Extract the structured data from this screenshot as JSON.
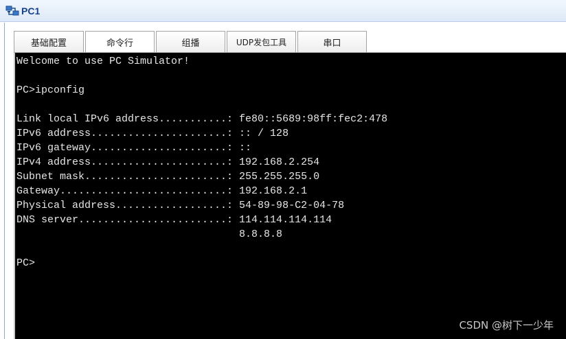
{
  "window": {
    "title": "PC1",
    "icon": "pc-network-icon"
  },
  "tabs": [
    {
      "label": "基础配置",
      "active": false
    },
    {
      "label": "命令行",
      "active": true
    },
    {
      "label": "组播",
      "active": false
    },
    {
      "label": "UDP发包工具",
      "active": false
    },
    {
      "label": "串口",
      "active": false
    }
  ],
  "terminal": {
    "lines": [
      "Welcome to use PC Simulator!",
      "",
      "PC>ipconfig",
      "",
      "Link local IPv6 address...........: fe80::5689:98ff:fec2:478",
      "IPv6 address......................: :: / 128",
      "IPv6 gateway......................: ::",
      "IPv4 address......................: 192.168.2.254",
      "Subnet mask.......................: 255.255.255.0",
      "Gateway...........................: 192.168.2.1",
      "Physical address..................: 54-89-98-C2-04-78",
      "DNS server........................: 114.114.114.114",
      "                                    8.8.8.8",
      "",
      "PC>"
    ]
  },
  "watermark": "CSDN @树下一少年"
}
